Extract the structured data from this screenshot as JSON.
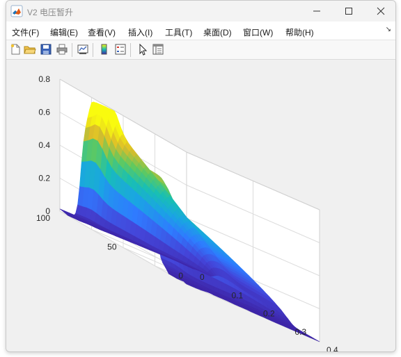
{
  "window": {
    "title": "V2 电压暂升"
  },
  "menu": [
    {
      "label": "文件(F)"
    },
    {
      "label": "编辑(E)"
    },
    {
      "label": "查看(V)"
    },
    {
      "label": "插入(I)"
    },
    {
      "label": "工具(T)"
    },
    {
      "label": "桌面(D)"
    },
    {
      "label": "窗口(W)"
    },
    {
      "label": "帮助(H)"
    }
  ],
  "toolbar": {
    "icons": [
      "new-file-icon",
      "open-folder-icon",
      "save-icon",
      "print-icon",
      "link-plot-icon",
      "colorbar-icon",
      "legend-icon",
      "pointer-icon",
      "property-editor-icon"
    ]
  },
  "chart_data": {
    "type": "surface",
    "title": "",
    "xlabel": "",
    "ylabel": "",
    "zlabel": "",
    "x_ticks": [
      "0",
      "0.1",
      "0.2",
      "0.3",
      "0.4"
    ],
    "y_ticks": [
      "0",
      "50",
      "100"
    ],
    "z_ticks": [
      "0",
      "0.2",
      "0.4",
      "0.6",
      "0.8"
    ],
    "xlim": [
      0,
      0.4
    ],
    "ylim": [
      0,
      100
    ],
    "zlim": [
      0,
      0.8
    ],
    "grid": true,
    "colormap": "parula",
    "colors": [
      "#3e26a8",
      "#4445d9",
      "#2f7bff",
      "#1aa5e3",
      "#19bfb3",
      "#5fc960",
      "#dcbc2a",
      "#f9fb0e"
    ],
    "description_points": {
      "z_at_sag_start": 0.0,
      "z_peak_fundamental": 0.62,
      "z_plateau_fundamental": 0.55,
      "z_after_event": 0.0
    }
  }
}
